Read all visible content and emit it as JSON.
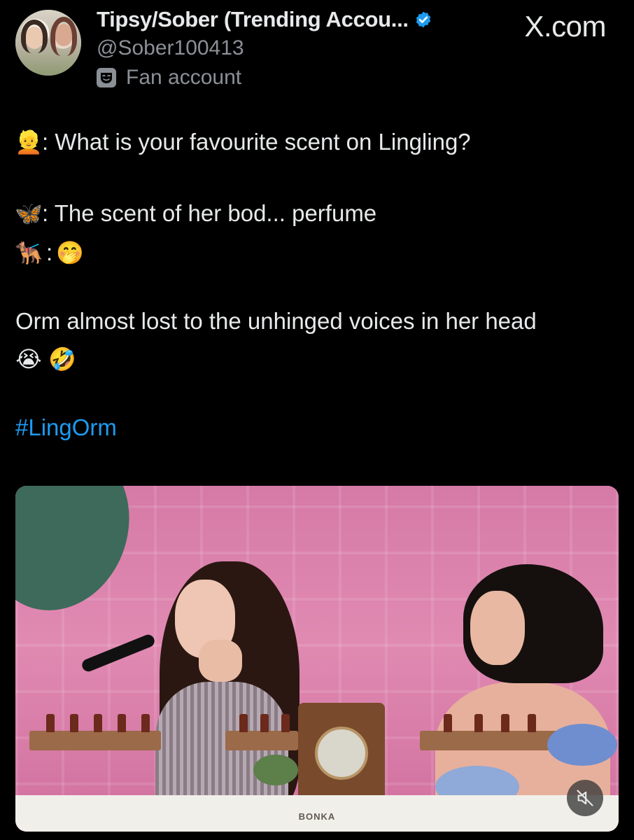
{
  "post": {
    "display_name": "Tipsy/Sober (Trending Accou...",
    "handle": "@Sober100413",
    "affiliation_label": "Fan account",
    "affiliation_icon": "theater-mask-icon",
    "verified": true,
    "source": "X.com"
  },
  "lines": {
    "line1_emoji": "👱",
    "line1_text": ": What is your favourite scent on Lingling?",
    "line2_emoji": "🦋",
    "line2_text": ": The scent of her bod... perfume",
    "line3_emoji": "🐕‍🦺",
    "line3_sep": ":",
    "line3_emoji2": "🤭",
    "line4_text": "Orm almost lost to the unhinged voices in her head",
    "line5_emoji1": "😭",
    "line5_emoji2": "🤣",
    "hashtag": "#LingOrm"
  },
  "media": {
    "table_label": "BONKA",
    "mute_icon": "muted-speaker-icon"
  },
  "colors": {
    "background": "#000000",
    "text": "#e7e9ea",
    "secondary": "#8b9096",
    "link": "#1d9bf0",
    "verified": "#1d9bf0"
  }
}
